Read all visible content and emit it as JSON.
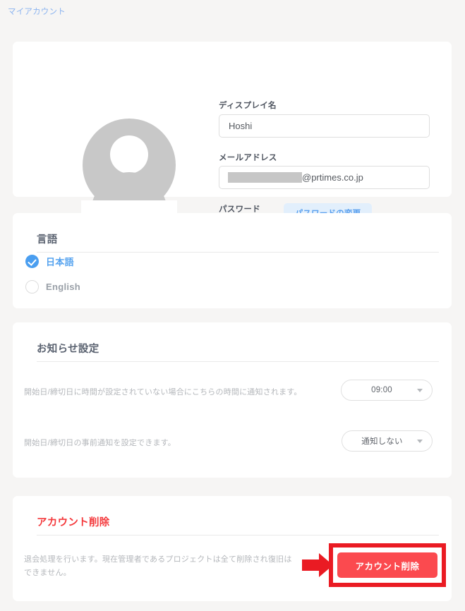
{
  "breadcrumb": {
    "label": "マイアカウント"
  },
  "profile": {
    "avatar_icon": "user-avatar-placeholder-icon",
    "display_name": {
      "label": "ディスプレイ名",
      "value": "Hoshi"
    },
    "email": {
      "label": "メールアドレス",
      "domain_suffix": "@prtimes.co.jp",
      "redacted": true
    },
    "password": {
      "label": "パスワード",
      "masked_value": "**********",
      "change_button": "パスワードの変更"
    }
  },
  "language": {
    "title": "言語",
    "options": [
      {
        "label": "日本語",
        "selected": true
      },
      {
        "label": "English",
        "selected": false
      }
    ]
  },
  "notifications": {
    "title": "お知らせ設定",
    "rows": [
      {
        "description": "開始日/締切日に時間が設定されていない場合にこちらの時間に通知されます。",
        "value": "09:00"
      },
      {
        "description": "開始日/締切日の事前通知を設定できます。",
        "value": "通知しない"
      }
    ]
  },
  "delete_account": {
    "title": "アカウント削除",
    "description": "退会処理を行います。現在管理者であるプロジェクトは全て削除され復旧はできません。",
    "button": "アカウント削除"
  },
  "annotation": {
    "arrow_icon": "right-arrow-annotation-icon",
    "highlight_color": "#ea1b23",
    "target": "アカウント削除"
  },
  "colors": {
    "page_background": "#f6f5f4",
    "card_background": "#ffffff",
    "accent_blue": "#4a9ef0",
    "link_blue": "#8cb4f0",
    "danger_red": "#f4393c",
    "delete_button_red": "#fb4a4f",
    "annotation_red": "#ea1b23"
  }
}
